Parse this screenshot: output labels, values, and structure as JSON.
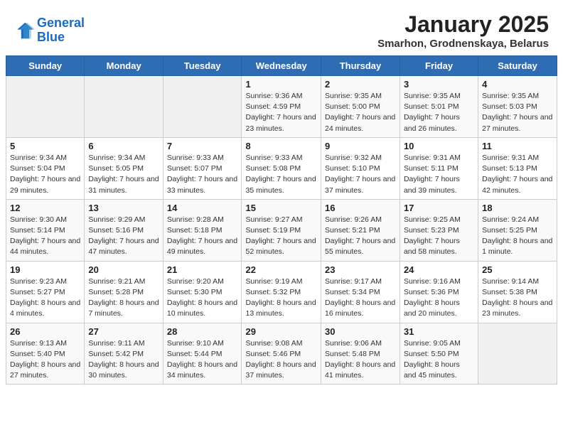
{
  "logo": {
    "line1": "General",
    "line2": "Blue"
  },
  "title": "January 2025",
  "subtitle": "Smarhon, Grodnenskaya, Belarus",
  "days_of_week": [
    "Sunday",
    "Monday",
    "Tuesday",
    "Wednesday",
    "Thursday",
    "Friday",
    "Saturday"
  ],
  "weeks": [
    [
      {
        "day": "",
        "content": ""
      },
      {
        "day": "",
        "content": ""
      },
      {
        "day": "",
        "content": ""
      },
      {
        "day": "1",
        "content": "Sunrise: 9:36 AM\nSunset: 4:59 PM\nDaylight: 7 hours\nand 23 minutes."
      },
      {
        "day": "2",
        "content": "Sunrise: 9:35 AM\nSunset: 5:00 PM\nDaylight: 7 hours\nand 24 minutes."
      },
      {
        "day": "3",
        "content": "Sunrise: 9:35 AM\nSunset: 5:01 PM\nDaylight: 7 hours\nand 26 minutes."
      },
      {
        "day": "4",
        "content": "Sunrise: 9:35 AM\nSunset: 5:03 PM\nDaylight: 7 hours\nand 27 minutes."
      }
    ],
    [
      {
        "day": "5",
        "content": "Sunrise: 9:34 AM\nSunset: 5:04 PM\nDaylight: 7 hours\nand 29 minutes."
      },
      {
        "day": "6",
        "content": "Sunrise: 9:34 AM\nSunset: 5:05 PM\nDaylight: 7 hours\nand 31 minutes."
      },
      {
        "day": "7",
        "content": "Sunrise: 9:33 AM\nSunset: 5:07 PM\nDaylight: 7 hours\nand 33 minutes."
      },
      {
        "day": "8",
        "content": "Sunrise: 9:33 AM\nSunset: 5:08 PM\nDaylight: 7 hours\nand 35 minutes."
      },
      {
        "day": "9",
        "content": "Sunrise: 9:32 AM\nSunset: 5:10 PM\nDaylight: 7 hours\nand 37 minutes."
      },
      {
        "day": "10",
        "content": "Sunrise: 9:31 AM\nSunset: 5:11 PM\nDaylight: 7 hours\nand 39 minutes."
      },
      {
        "day": "11",
        "content": "Sunrise: 9:31 AM\nSunset: 5:13 PM\nDaylight: 7 hours\nand 42 minutes."
      }
    ],
    [
      {
        "day": "12",
        "content": "Sunrise: 9:30 AM\nSunset: 5:14 PM\nDaylight: 7 hours\nand 44 minutes."
      },
      {
        "day": "13",
        "content": "Sunrise: 9:29 AM\nSunset: 5:16 PM\nDaylight: 7 hours\nand 47 minutes."
      },
      {
        "day": "14",
        "content": "Sunrise: 9:28 AM\nSunset: 5:18 PM\nDaylight: 7 hours\nand 49 minutes."
      },
      {
        "day": "15",
        "content": "Sunrise: 9:27 AM\nSunset: 5:19 PM\nDaylight: 7 hours\nand 52 minutes."
      },
      {
        "day": "16",
        "content": "Sunrise: 9:26 AM\nSunset: 5:21 PM\nDaylight: 7 hours\nand 55 minutes."
      },
      {
        "day": "17",
        "content": "Sunrise: 9:25 AM\nSunset: 5:23 PM\nDaylight: 7 hours\nand 58 minutes."
      },
      {
        "day": "18",
        "content": "Sunrise: 9:24 AM\nSunset: 5:25 PM\nDaylight: 8 hours\nand 1 minute."
      }
    ],
    [
      {
        "day": "19",
        "content": "Sunrise: 9:23 AM\nSunset: 5:27 PM\nDaylight: 8 hours\nand 4 minutes."
      },
      {
        "day": "20",
        "content": "Sunrise: 9:21 AM\nSunset: 5:28 PM\nDaylight: 8 hours\nand 7 minutes."
      },
      {
        "day": "21",
        "content": "Sunrise: 9:20 AM\nSunset: 5:30 PM\nDaylight: 8 hours\nand 10 minutes."
      },
      {
        "day": "22",
        "content": "Sunrise: 9:19 AM\nSunset: 5:32 PM\nDaylight: 8 hours\nand 13 minutes."
      },
      {
        "day": "23",
        "content": "Sunrise: 9:17 AM\nSunset: 5:34 PM\nDaylight: 8 hours\nand 16 minutes."
      },
      {
        "day": "24",
        "content": "Sunrise: 9:16 AM\nSunset: 5:36 PM\nDaylight: 8 hours\nand 20 minutes."
      },
      {
        "day": "25",
        "content": "Sunrise: 9:14 AM\nSunset: 5:38 PM\nDaylight: 8 hours\nand 23 minutes."
      }
    ],
    [
      {
        "day": "26",
        "content": "Sunrise: 9:13 AM\nSunset: 5:40 PM\nDaylight: 8 hours\nand 27 minutes."
      },
      {
        "day": "27",
        "content": "Sunrise: 9:11 AM\nSunset: 5:42 PM\nDaylight: 8 hours\nand 30 minutes."
      },
      {
        "day": "28",
        "content": "Sunrise: 9:10 AM\nSunset: 5:44 PM\nDaylight: 8 hours\nand 34 minutes."
      },
      {
        "day": "29",
        "content": "Sunrise: 9:08 AM\nSunset: 5:46 PM\nDaylight: 8 hours\nand 37 minutes."
      },
      {
        "day": "30",
        "content": "Sunrise: 9:06 AM\nSunset: 5:48 PM\nDaylight: 8 hours\nand 41 minutes."
      },
      {
        "day": "31",
        "content": "Sunrise: 9:05 AM\nSunset: 5:50 PM\nDaylight: 8 hours\nand 45 minutes."
      },
      {
        "day": "",
        "content": ""
      }
    ]
  ]
}
